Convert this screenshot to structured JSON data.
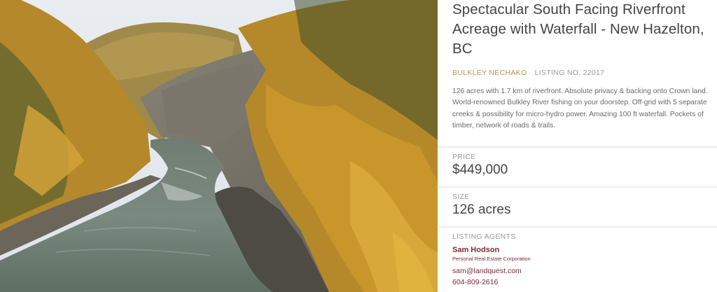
{
  "listing": {
    "title": "Spectacular South Facing Riverfront Acreage with Waterfall - New Hazelton, BC",
    "region": "BULKLEY NECHAKO",
    "listing_no": "LISTING NO. 22017",
    "description": "126 acres with 1.7 km of riverfront. Absolute privacy & backing onto Crown land. World-renowned Bulkley River fishing on your doorstep. Off-grid with 5 separate creeks & possibility for micro-hydro power. Amazing 100 ft waterfall. Pockets of timber, network of roads & trails."
  },
  "price": {
    "label": "PRICE",
    "value": "$449,000"
  },
  "size": {
    "label": "SIZE",
    "value": "126 acres"
  },
  "agents": {
    "label": "LISTING AGENTS",
    "name": "Sam Hodson",
    "company": "Personal Real Estate Corporation",
    "email": "sam@landquest.com",
    "phone": "604-809-2616"
  },
  "colors": {
    "accent": "#b89555",
    "agent": "#7a2a35",
    "text": "#444444"
  }
}
